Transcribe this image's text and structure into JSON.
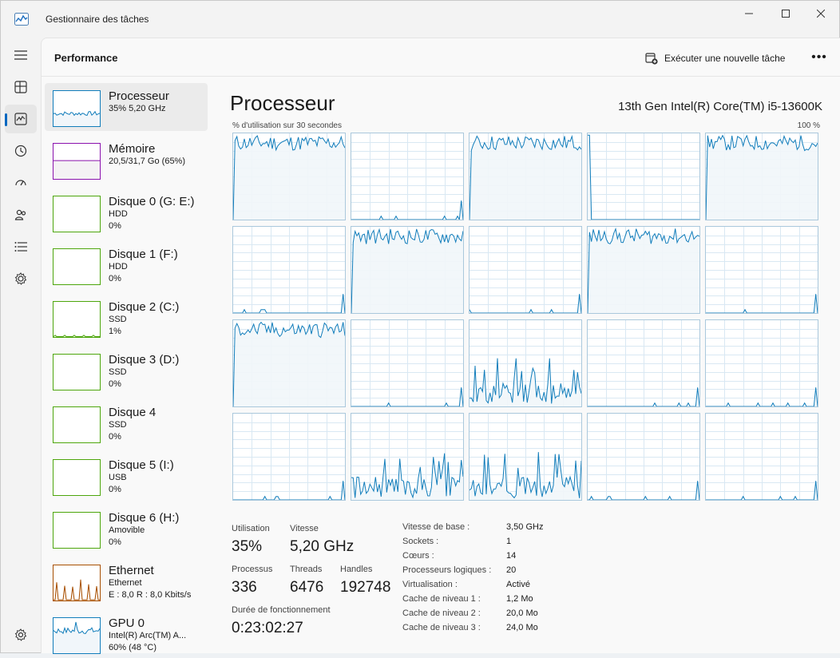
{
  "window": {
    "title": "Gestionnaire des tâches",
    "minimize_icon": "minimize-icon",
    "maximize_icon": "maximize-icon",
    "close_icon": "close-icon"
  },
  "nav": [
    {
      "icon": "hamburger-menu-icon"
    },
    {
      "icon": "processes-icon"
    },
    {
      "icon": "performance-icon",
      "active": true
    },
    {
      "icon": "app-history-icon"
    },
    {
      "icon": "startup-apps-icon"
    },
    {
      "icon": "users-icon"
    },
    {
      "icon": "details-icon"
    },
    {
      "icon": "services-icon"
    }
  ],
  "settings_icon": "gear-icon",
  "header": {
    "title": "Performance",
    "run_new_task": "Exécuter une nouvelle tâche",
    "more": "•••"
  },
  "sidebar": [
    {
      "name": "Processeur",
      "sub1": "35% 5,20 GHz",
      "sub2": "",
      "color": "#117dbb",
      "fill": "#f1f6fa",
      "selected": true
    },
    {
      "name": "Mémoire",
      "sub1": "20,5/31,7 Go (65%)",
      "sub2": "",
      "color": "#8b12ae",
      "fill": "#f4f2f4"
    },
    {
      "name": "Disque 0 (G: E:)",
      "sub1": "HDD",
      "sub2": "0%",
      "color": "#4da60c"
    },
    {
      "name": "Disque 1 (F:)",
      "sub1": "HDD",
      "sub2": "0%",
      "color": "#4da60c"
    },
    {
      "name": "Disque 2 (C:)",
      "sub1": "SSD",
      "sub2": "1%",
      "color": "#4da60c"
    },
    {
      "name": "Disque 3 (D:)",
      "sub1": "SSD",
      "sub2": "0%",
      "color": "#4da60c"
    },
    {
      "name": "Disque 4",
      "sub1": "SSD",
      "sub2": "0%",
      "color": "#4da60c"
    },
    {
      "name": "Disque 5 (I:)",
      "sub1": "USB",
      "sub2": "0%",
      "color": "#4da60c"
    },
    {
      "name": "Disque 6 (H:)",
      "sub1": "Amovible",
      "sub2": "0%",
      "color": "#4da60c"
    },
    {
      "name": "Ethernet",
      "sub1": "Ethernet",
      "sub2": "E : 8,0  R : 8,0 Kbits/s",
      "color": "#a74f01"
    },
    {
      "name": "GPU 0",
      "sub1": "Intel(R) Arc(TM) A...",
      "sub2": "60% (48 °C)",
      "color": "#117dbb"
    }
  ],
  "main": {
    "title": "Processeur",
    "model": "13th Gen Intel(R) Core(TM) i5-13600K",
    "util_label": "% d'utilisation sur 30 secondes",
    "util_max": "100 %",
    "graph_color": "#117dbb",
    "graph_fill": "#f1f6fa",
    "stats": {
      "utilisation_label": "Utilisation",
      "utilisation": "35%",
      "vitesse_label": "Vitesse",
      "vitesse": "5,20 GHz",
      "processus_label": "Processus",
      "processus": "336",
      "threads_label": "Threads",
      "threads": "6476",
      "handles_label": "Handles",
      "handles": "192748",
      "duree_label": "Durée de fonctionnement",
      "duree": "0:23:02:27"
    },
    "specs": [
      {
        "key": "Vitesse de base :",
        "value": "3,50 GHz"
      },
      {
        "key": "Sockets :",
        "value": "1"
      },
      {
        "key": "Cœurs :",
        "value": "14"
      },
      {
        "key": "Processeurs logiques :",
        "value": "20"
      },
      {
        "key": "Virtualisation :",
        "value": "Activé"
      },
      {
        "key": "Cache de niveau 1 :",
        "value": "1,2 Mo"
      },
      {
        "key": "Cache de niveau 2 :",
        "value": "20,0 Mo"
      },
      {
        "key": "Cache de niveau 3 :",
        "value": "24,0 Mo"
      }
    ],
    "core_levels": [
      "high",
      "low",
      "high",
      "spike-drop",
      "high",
      "low",
      "high",
      "low",
      "high",
      "low",
      "high",
      "low",
      "medium",
      "low",
      "low",
      "low",
      "medium",
      "medium",
      "low",
      "low"
    ]
  }
}
